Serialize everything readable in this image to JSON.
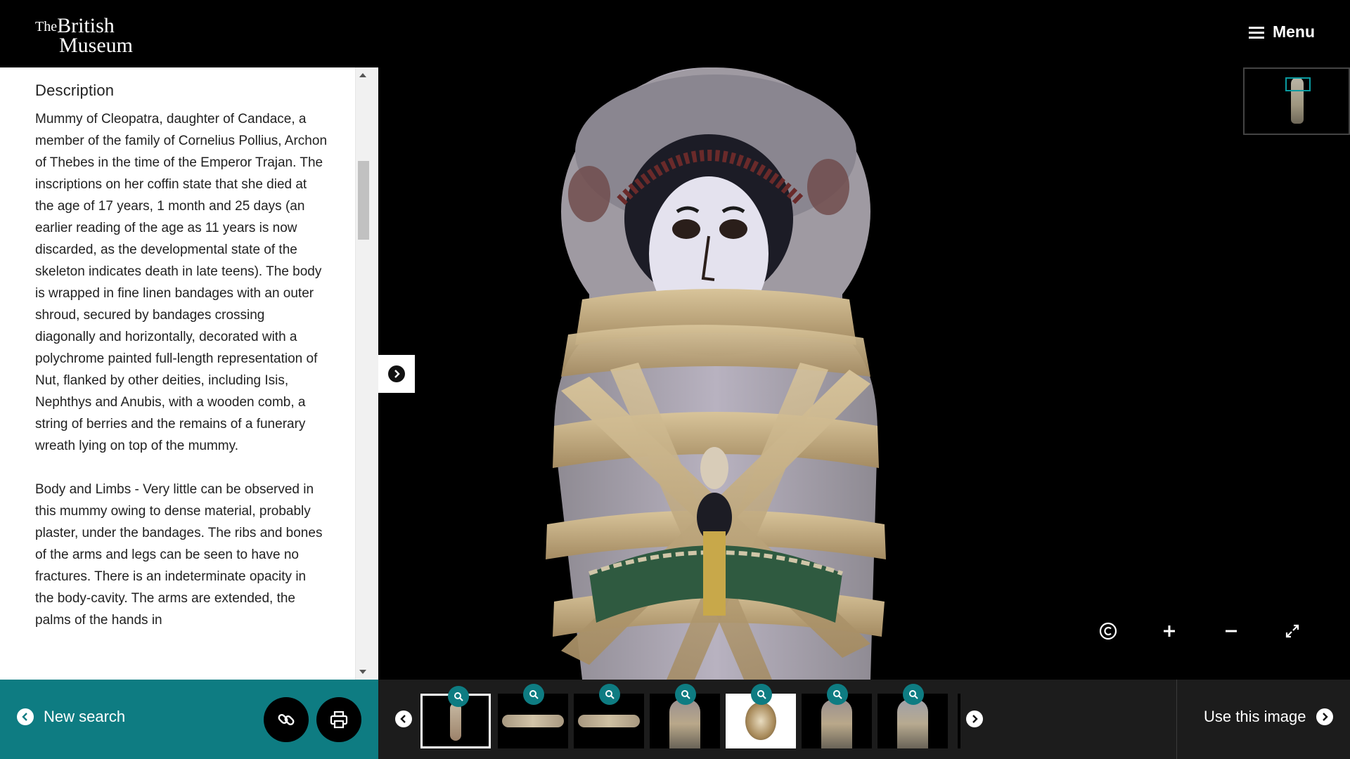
{
  "header": {
    "logo_the": "The",
    "logo_line1": "British",
    "logo_line2": "Museum",
    "menu_label": "Menu"
  },
  "description": {
    "heading": "Description",
    "paragraphs": [
      "Mummy of Cleopatra, daughter of Candace, a member of the family of Cornelius Pollius, Archon of Thebes in the time of the Emperor Trajan. The inscriptions on her coffin state that she died at the age of 17 years, 1 month and 25 days (an earlier reading of the age as 11 years is now discarded, as the developmental state of the skeleton indicates death in late teens). The body is wrapped in fine linen bandages with an outer shroud, secured by bandages crossing diagonally and horizontally, decorated with a polychrome painted full-length representation of Nut, flanked by other deities, including Isis, Nephthys and Anubis, with a wooden comb, a string of berries and the remains of a funerary wreath lying on top of the mummy.",
      "Body and Limbs - Very little can be observed in this mummy owing to dense material, probably plaster, under the bandages. The ribs and bones of the arms and legs can be seen to have no fractures. There is an indeterminate opacity in the body-cavity. The arms are extended, the palms of the hands in"
    ]
  },
  "footer": {
    "new_search_label": "New search",
    "use_image_label": "Use this image"
  },
  "viewer": {
    "controls": [
      "copyright-icon",
      "zoom-in-icon",
      "zoom-out-icon",
      "fullscreen-icon"
    ]
  },
  "colors": {
    "teal": "#0e7c82",
    "dark_bar": "#1c1c1c",
    "background": "#000000"
  }
}
